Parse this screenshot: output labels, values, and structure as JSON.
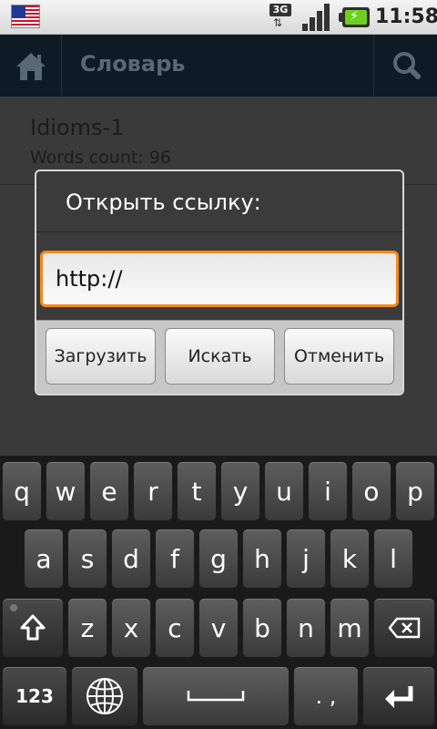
{
  "status_bar": {
    "flag_icon": "us-flag-icon",
    "network_label": "3G",
    "time": "11:58"
  },
  "app_bar": {
    "title": "Словарь",
    "home_icon": "home-icon",
    "search_icon": "search-icon"
  },
  "list": {
    "items": [
      {
        "title": "Idioms-1",
        "subtitle": "Words count: 96"
      }
    ]
  },
  "dialog": {
    "title": "Открыть ссылку:",
    "input_value": "http://",
    "buttons": {
      "load": "Загрузить",
      "search": "Искать",
      "cancel": "Отменить"
    }
  },
  "keyboard": {
    "row1": [
      "q",
      "w",
      "e",
      "r",
      "t",
      "y",
      "u",
      "i",
      "o",
      "p"
    ],
    "row2": [
      "a",
      "s",
      "d",
      "f",
      "g",
      "h",
      "j",
      "k",
      "l"
    ],
    "row3": [
      "z",
      "x",
      "c",
      "v",
      "b",
      "n",
      "m"
    ],
    "numbers_label": "123",
    "punct_label": ". ,",
    "space_label": "___"
  },
  "colors": {
    "accent_orange": "#f28a1a",
    "app_bar_bg": "#0e1a26",
    "battery_green": "#6fcf1f"
  }
}
